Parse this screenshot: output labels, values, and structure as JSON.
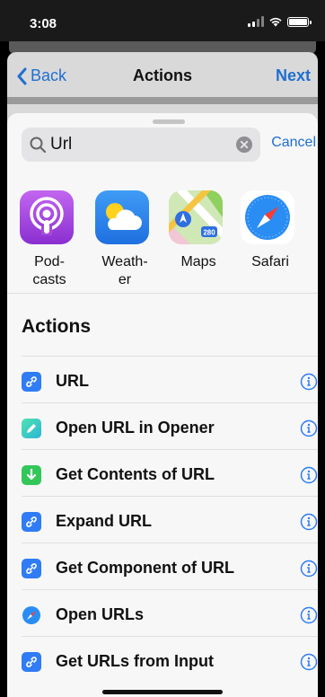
{
  "status": {
    "time": "3:08"
  },
  "nav": {
    "back_label": "Back",
    "title": "Actions",
    "next_label": "Next"
  },
  "search": {
    "value": "Url",
    "cancel_label": "Cancel"
  },
  "apps": [
    {
      "label": "Pod-\ncasts",
      "icon": "podcasts-icon"
    },
    {
      "label": "Weath-\ner",
      "icon": "weather-icon"
    },
    {
      "label": "Maps",
      "icon": "maps-icon"
    },
    {
      "label": "Safari",
      "icon": "safari-icon"
    }
  ],
  "section": {
    "title": "Actions"
  },
  "actions": [
    {
      "label": "URL",
      "icon": "link-icon"
    },
    {
      "label": "Open URL in Opener",
      "icon": "pencil-icon"
    },
    {
      "label": "Get Contents of URL",
      "icon": "download-arrow-icon"
    },
    {
      "label": "Expand URL",
      "icon": "link-icon"
    },
    {
      "label": "Get Component of URL",
      "icon": "link-icon"
    },
    {
      "label": "Open URLs",
      "icon": "safari-compass-icon"
    },
    {
      "label": "Get URLs from Input",
      "icon": "link-icon"
    }
  ],
  "colors": {
    "accent": "#1f6fd1",
    "link_blue": "#2f7cf6",
    "opener_green": "#3fd0a0",
    "download_green": "#33c759",
    "podcasts_purple": "#a44bdc",
    "weather_blue": "#2e8cf0"
  }
}
